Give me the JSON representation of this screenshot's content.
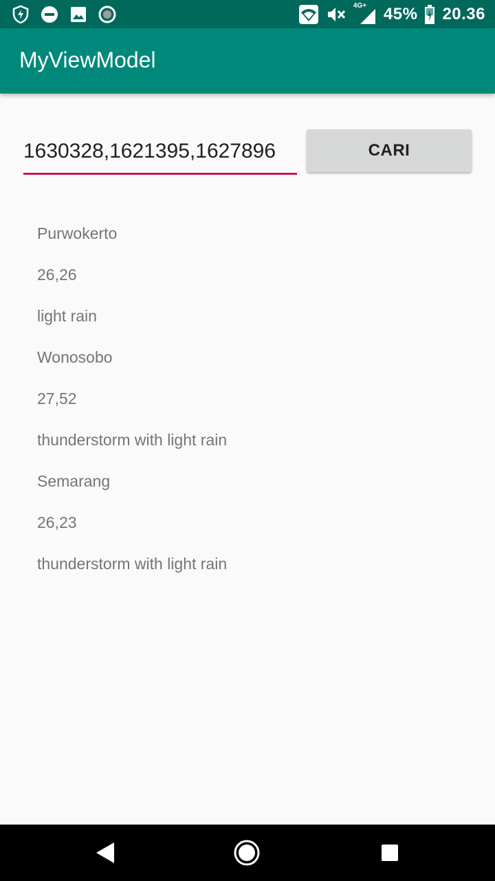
{
  "status_bar": {
    "left_icons": [
      "shield-bolt-icon",
      "do-not-disturb-icon",
      "image-icon",
      "record-icon"
    ],
    "right_icons": [
      "wifi-icon",
      "volume-mute-icon",
      "signal-4g-icon",
      "battery-charging-icon"
    ],
    "network_label": "4G+",
    "battery": "45%",
    "time": "20.36"
  },
  "app_bar": {
    "title": "MyViewModel"
  },
  "search": {
    "value": "1630328,1621395,1627896",
    "button_label": "CARI"
  },
  "results": [
    "Purwokerto",
    "26,26",
    "light rain",
    "Wonosobo",
    "27,52",
    "thunderstorm with light rain",
    "Semarang",
    "26,23",
    "thunderstorm with light rain"
  ],
  "nav_bar": {
    "buttons": [
      "back-icon",
      "home-icon",
      "recents-icon"
    ]
  },
  "colors": {
    "status_bar": "#00695c",
    "app_bar": "#00897b",
    "accent": "#c2185b",
    "button": "#d6d7d7",
    "background": "#fafafa"
  }
}
